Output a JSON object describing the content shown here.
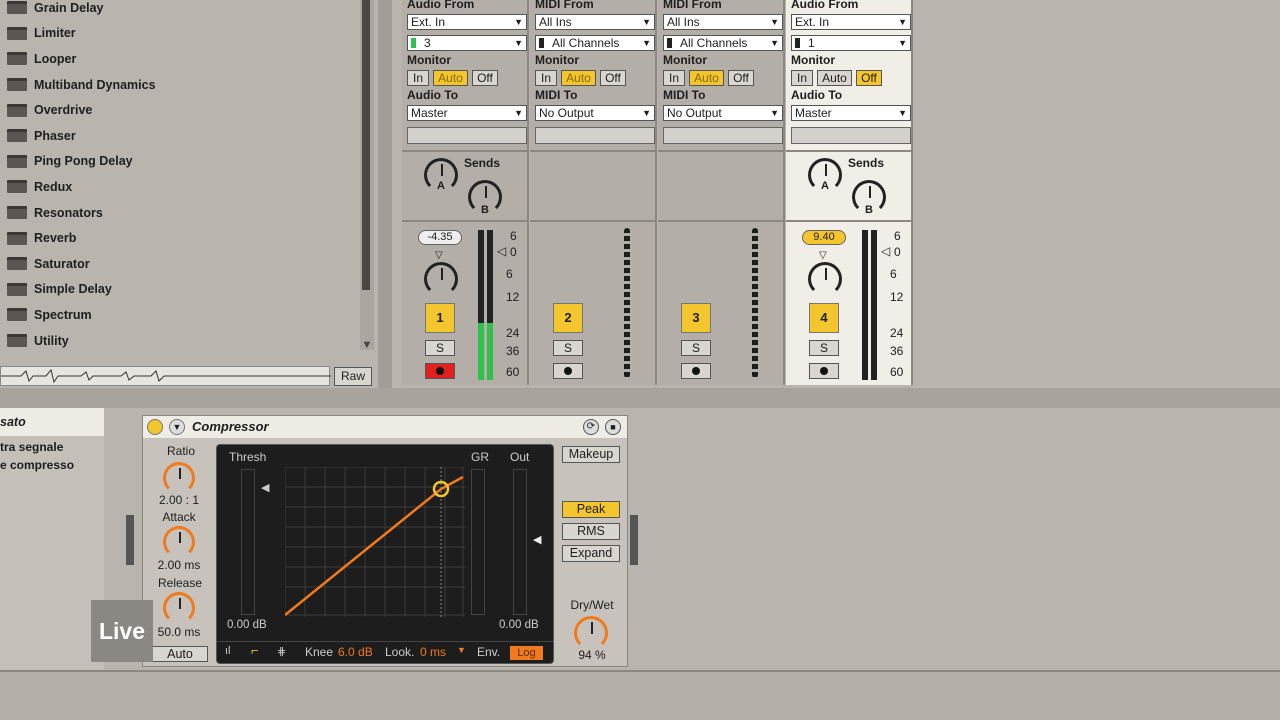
{
  "browser": {
    "items": [
      "Grain Delay",
      "Limiter",
      "Looper",
      "Multiband Dynamics",
      "Overdrive",
      "Phaser",
      "Ping Pong Delay",
      "Redux",
      "Resonators",
      "Reverb",
      "Saturator",
      "Simple Delay",
      "Spectrum",
      "Utility"
    ],
    "raw_label": "Raw"
  },
  "tracks": [
    {
      "io_head1": "Audio From",
      "src": "Ext. In",
      "chan": "3",
      "mon_head": "Monitor",
      "mon": [
        "In",
        "Auto",
        "Off"
      ],
      "out_head": "Audio To",
      "out": "Master",
      "sends": "Sends",
      "send_a": "A",
      "send_b": "B",
      "vol": "-4.35",
      "num": "1",
      "solo": "S"
    },
    {
      "io_head1": "MIDI From",
      "src": "All Ins",
      "chan": "All Channels",
      "mon_head": "Monitor",
      "mon": [
        "In",
        "Auto",
        "Off"
      ],
      "out_head": "MIDI To",
      "out": "No Output",
      "num": "2",
      "solo": "S"
    },
    {
      "io_head1": "MIDI From",
      "src": "All Ins",
      "chan": "All Channels",
      "mon_head": "Monitor",
      "mon": [
        "In",
        "Auto",
        "Off"
      ],
      "out_head": "MIDI To",
      "out": "No Output",
      "num": "3",
      "solo": "S"
    },
    {
      "io_head1": "Audio From",
      "src": "Ext. In",
      "chan": "1",
      "mon_head": "Monitor",
      "mon": [
        "In",
        "Auto",
        "Off"
      ],
      "out_head": "Audio To",
      "out": "Master",
      "sends": "Sends",
      "send_a": "A",
      "send_b": "B",
      "vol": "9.40",
      "num": "4",
      "solo": "S"
    }
  ],
  "scale": [
    "6",
    "0",
    "6",
    "12",
    "24",
    "36",
    "60"
  ],
  "device_left": {
    "title": "sato",
    "line1": "tra segnale",
    "line2": "e compresso"
  },
  "compressor": {
    "title": "Compressor",
    "ratio_label": "Ratio",
    "ratio": "2.00 : 1",
    "attack_label": "Attack",
    "attack": "2.00 ms",
    "release_label": "Release",
    "release": "50.0 ms",
    "auto": "Auto",
    "thresh": "Thresh",
    "gr": "GR",
    "out": "Out",
    "thresh_val": "0.00 dB",
    "out_val": "0.00 dB",
    "knee_label": "Knee",
    "knee": "6.0 dB",
    "look_label": "Look.",
    "look": "0 ms",
    "env_label": "Env.",
    "env": "Log",
    "makeup": "Makeup",
    "peak": "Peak",
    "rms": "RMS",
    "expand": "Expand",
    "drywet_label": "Dry/Wet",
    "drywet": "94 %"
  },
  "logo": "Live",
  "colors": {
    "accent": "#f2c62c",
    "arm_red": "#e22020",
    "curve_orange": "#f07a1c"
  }
}
